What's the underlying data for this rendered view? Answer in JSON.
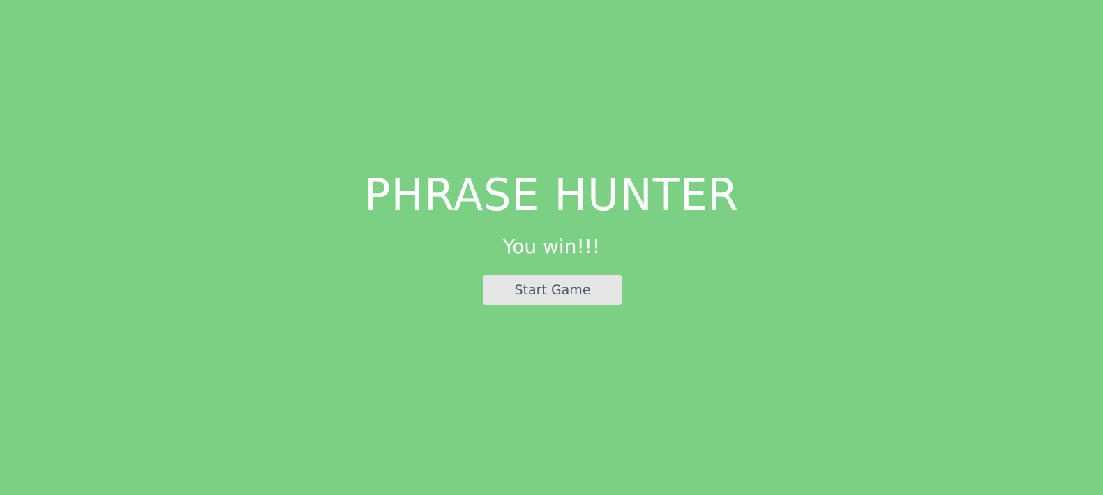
{
  "game": {
    "title": "PHRASE HUNTER",
    "message": "You win!!!",
    "start_button_label": "Start Game"
  },
  "colors": {
    "background": "#7bd084",
    "title_text": "#ffffff",
    "button_background": "#e5e5e5",
    "button_text": "#4f5a66"
  }
}
